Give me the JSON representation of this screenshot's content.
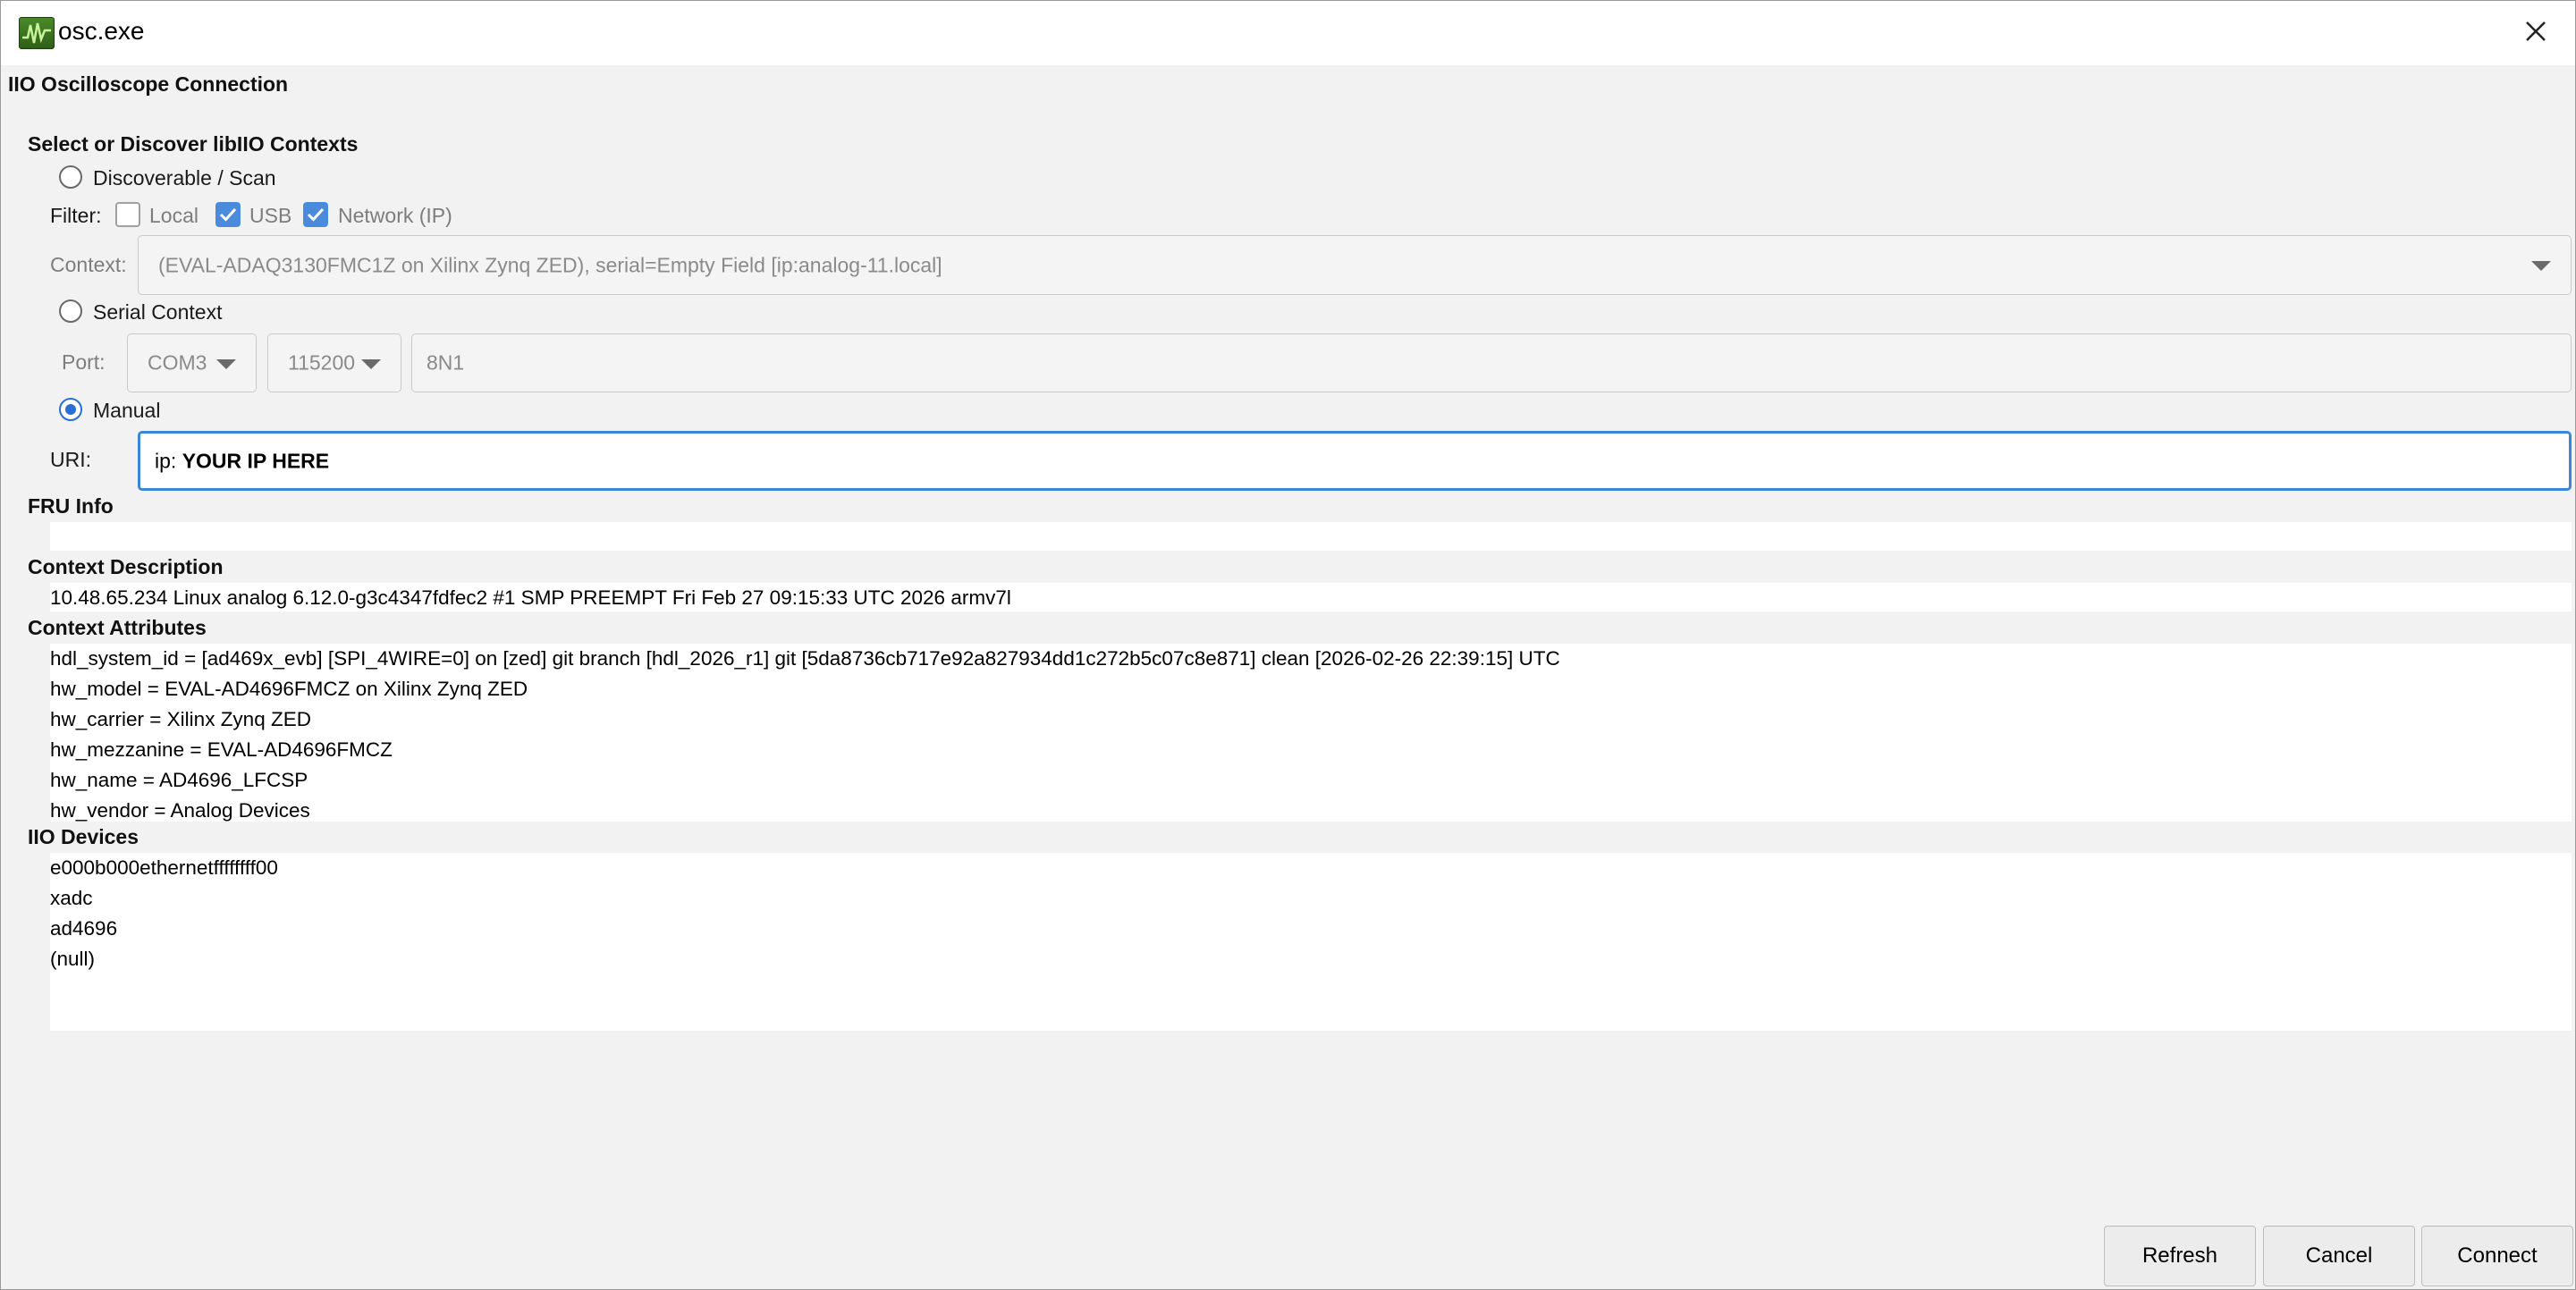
{
  "window": {
    "title": "osc.exe",
    "icon": "oscilloscope-app-icon",
    "close_icon": "close-icon"
  },
  "dialog": {
    "heading": "IIO Oscilloscope Connection"
  },
  "select_section": {
    "heading": "Select or Discover libIIO Contexts",
    "discoverable_label": "Discoverable / Scan",
    "filter_label": "Filter:",
    "filters": [
      {
        "label": "Local",
        "checked": false
      },
      {
        "label": "USB",
        "checked": true
      },
      {
        "label": "Network (IP)",
        "checked": true
      }
    ],
    "context_label": "Context:",
    "context_value": "(EVAL-ADAQ3130FMC1Z on Xilinx Zynq ZED), serial=Empty Field [ip:analog-11.local]",
    "serial_label": "Serial Context",
    "port_label": "Port:",
    "port_value": "COM3",
    "baud_value": "115200",
    "serial_config": "8N1",
    "manual_label": "Manual",
    "selected_mode": "Manual",
    "uri_label": "URI:",
    "uri_prefix": "ip: ",
    "uri_value": "YOUR IP HERE"
  },
  "fru_info": {
    "heading": "FRU Info"
  },
  "context_description": {
    "heading": "Context Description",
    "text": "10.48.65.234 Linux analog 6.12.0-g3c4347fdfec2 #1 SMP PREEMPT Fri Feb 27 09:15:33 UTC 2026 armv7l"
  },
  "context_attributes": {
    "heading": "Context Attributes",
    "items": [
      "hdl_system_id = [ad469x_evb] [SPI_4WIRE=0] on [zed] git branch [hdl_2026_r1] git [5da8736cb717e92a827934dd1c272b5c07c8e871] clean [2026-02-26 22:39:15] UTC",
      "hw_model = EVAL-AD4696FMCZ on Xilinx Zynq ZED",
      "hw_carrier = Xilinx Zynq ZED",
      "hw_mezzanine = EVAL-AD4696FMCZ",
      "hw_name = AD4696_LFCSP",
      "hw_vendor = Analog Devices"
    ]
  },
  "iio_devices": {
    "heading": "IIO Devices",
    "items": [
      "e000b000ethernetffffffff00",
      "xadc",
      "ad4696",
      "(null)"
    ]
  },
  "buttons": {
    "refresh": "Refresh",
    "cancel": "Cancel",
    "connect": "Connect"
  },
  "colors": {
    "accent": "#2a6fd6",
    "checkbox_checked": "#4b8bdc",
    "focus_border": "#3a87d8"
  }
}
